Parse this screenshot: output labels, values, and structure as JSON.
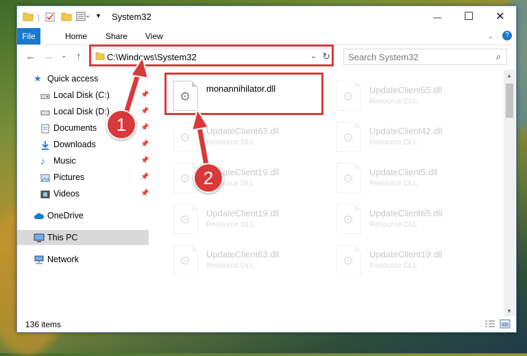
{
  "window": {
    "title": "System32",
    "minimize": "—",
    "maximize": "☐",
    "close": "✕"
  },
  "ribbon": {
    "tabs": [
      "File",
      "Home",
      "Share",
      "View"
    ]
  },
  "address": {
    "path": "C:\\Windows\\System32",
    "search_placeholder": "Search System32"
  },
  "nav": {
    "items": [
      {
        "label": "Quick access",
        "icon": "star-icon"
      },
      {
        "label": "Local Disk (C:)",
        "icon": "drive-icon"
      },
      {
        "label": "Local Disk (D:)",
        "icon": "drive-icon"
      },
      {
        "label": "Documents",
        "icon": "documents-icon"
      },
      {
        "label": "Downloads",
        "icon": "downloads-icon"
      },
      {
        "label": "Music",
        "icon": "music-icon"
      },
      {
        "label": "Pictures",
        "icon": "pictures-icon"
      },
      {
        "label": "Videos",
        "icon": "videos-icon"
      },
      {
        "label": "OneDrive",
        "icon": "cloud-icon"
      },
      {
        "label": "This PC",
        "icon": "computer-icon"
      },
      {
        "label": "Network",
        "icon": "network-icon"
      }
    ]
  },
  "files": [
    {
      "name": "monannihilator.dll",
      "type": ""
    },
    {
      "name": "UpdateClient65.dll",
      "type": "Resource DLL"
    },
    {
      "name": "UpdateClient63.dll",
      "type": "Resource DLL"
    },
    {
      "name": "UpdateClient42.dll",
      "type": "Resource DLL"
    },
    {
      "name": "UpdateClient19.dll",
      "type": "Resource DLL"
    },
    {
      "name": "UpdateClient5.dll",
      "type": "Resource DLL"
    },
    {
      "name": "UpdateClient19.dll",
      "type": "Resource DLL"
    },
    {
      "name": "UpdateClient65.dll",
      "type": "Resource DLL"
    },
    {
      "name": "UpdateClient63.dll",
      "type": "Resource DLL"
    },
    {
      "name": "UpdateClient19.dll",
      "type": "Resource DLL"
    }
  ],
  "status": {
    "item_count": "136 items"
  },
  "annotations": {
    "step1": "1",
    "step2": "2",
    "color": "#d9393a"
  }
}
